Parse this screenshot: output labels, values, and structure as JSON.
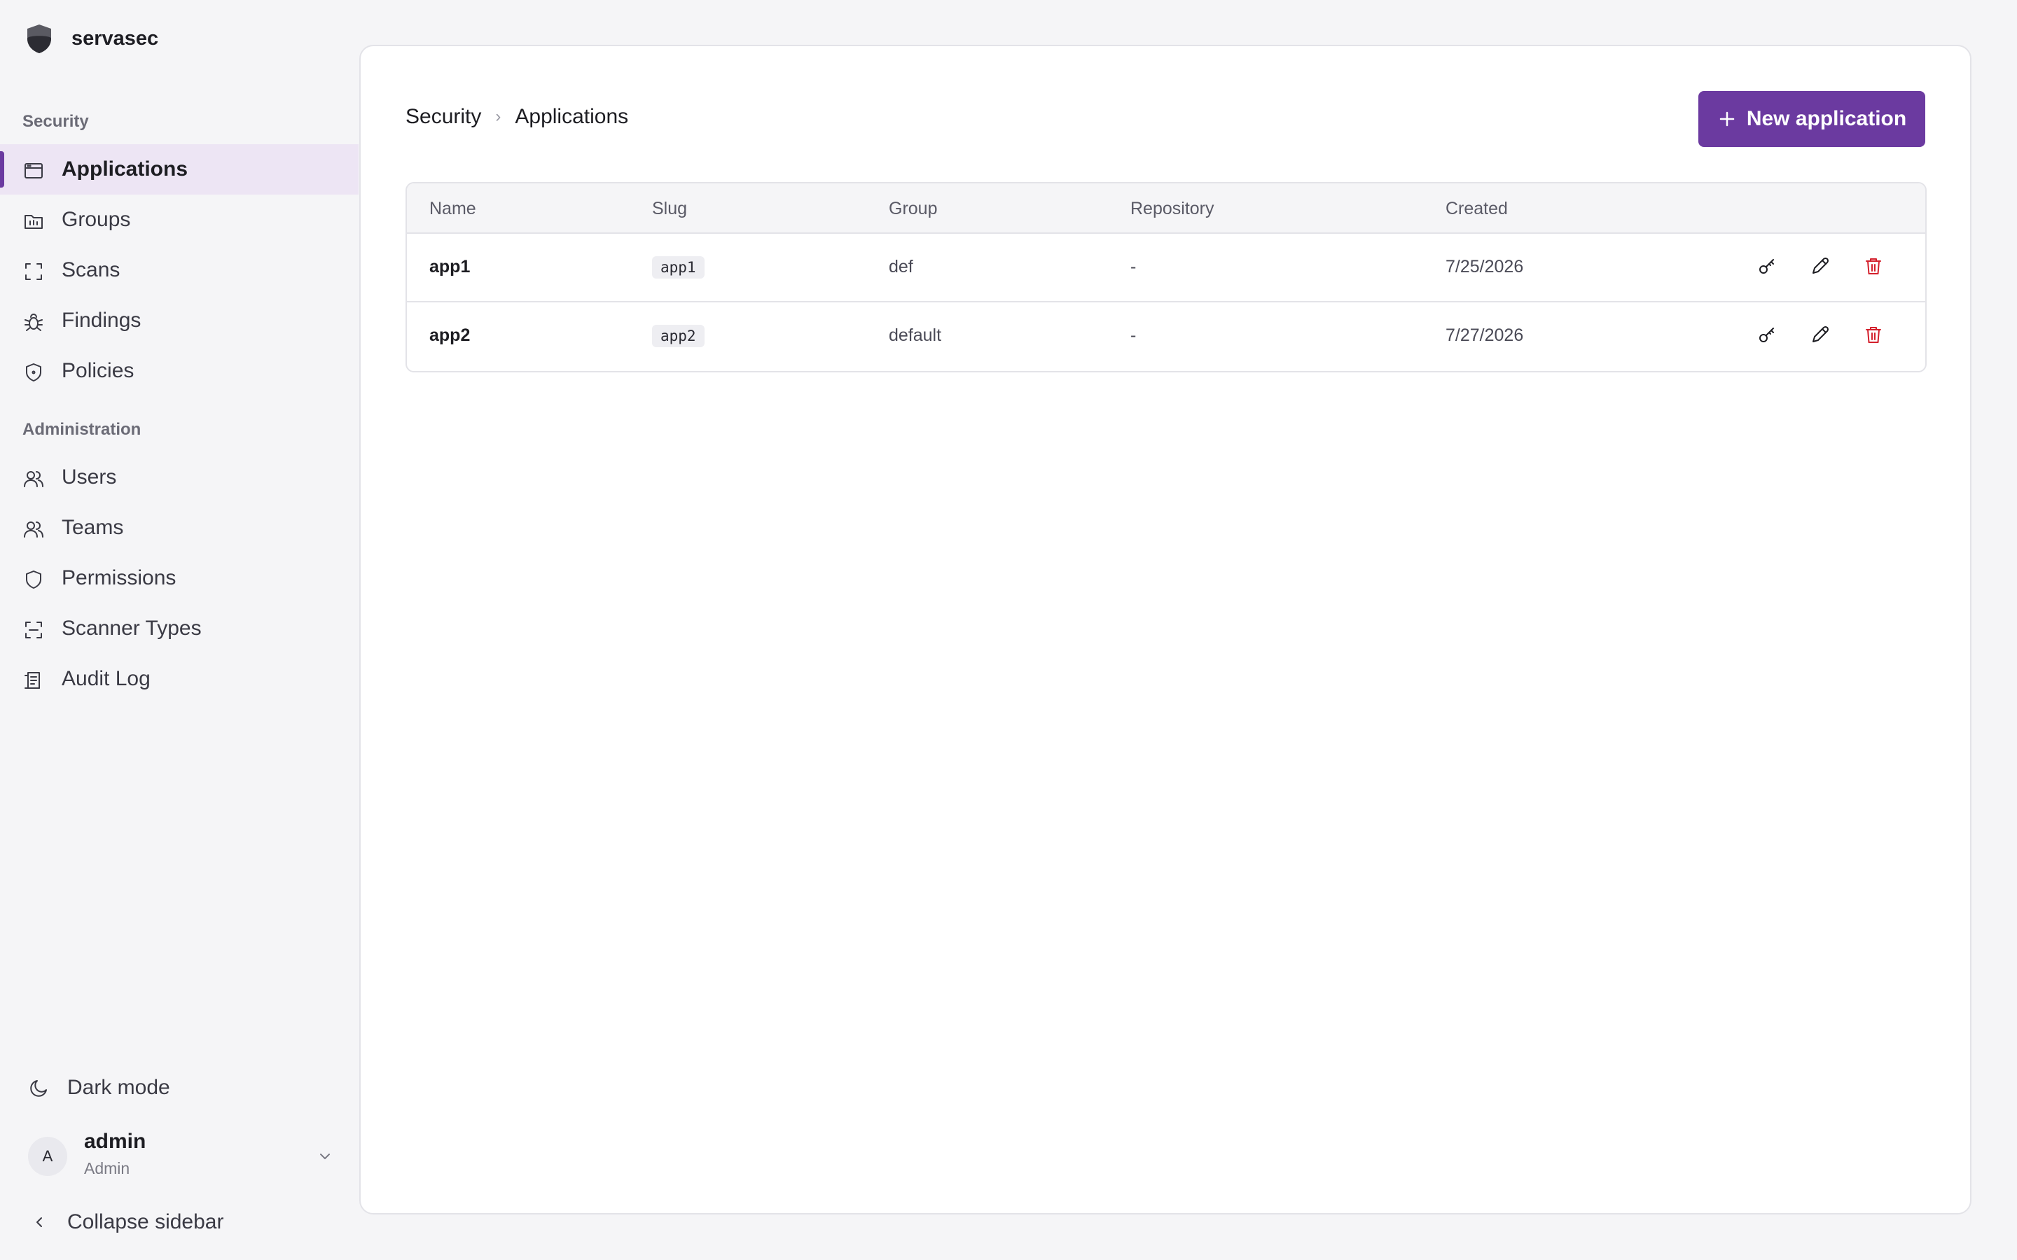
{
  "brand": {
    "name": "servasec"
  },
  "sidebar": {
    "security_label": "Security",
    "security_items": [
      {
        "label": "Applications",
        "icon": "applications-icon",
        "active": true
      },
      {
        "label": "Groups",
        "icon": "folder-icon"
      },
      {
        "label": "Scans",
        "icon": "scan-icon"
      },
      {
        "label": "Findings",
        "icon": "bug-icon"
      },
      {
        "label": "Policies",
        "icon": "shield-icon"
      }
    ],
    "admin_label": "Administration",
    "admin_items": [
      {
        "label": "Users",
        "icon": "users-icon"
      },
      {
        "label": "Teams",
        "icon": "teams-icon"
      },
      {
        "label": "Permissions",
        "icon": "shield-icon"
      },
      {
        "label": "Scanner Types",
        "icon": "scan-icon"
      },
      {
        "label": "Audit Log",
        "icon": "audit-log-icon"
      }
    ],
    "dark_mode_label": "Dark mode",
    "user": {
      "initial": "A",
      "name": "admin",
      "role": "Admin"
    },
    "collapse_label": "Collapse sidebar"
  },
  "header": {
    "breadcrumb": [
      "Security",
      "Applications"
    ],
    "new_button_label": "New application"
  },
  "table": {
    "columns": [
      "Name",
      "Slug",
      "Group",
      "Repository",
      "Created"
    ],
    "rows": [
      {
        "name": "app1",
        "slug": "app1",
        "group": "def",
        "repository": "-",
        "created": "7/25/2026"
      },
      {
        "name": "app2",
        "slug": "app2",
        "group": "default",
        "repository": "-",
        "created": "7/27/2026"
      }
    ]
  },
  "colors": {
    "accent": "#6b3aa0",
    "danger": "#d4202c"
  }
}
